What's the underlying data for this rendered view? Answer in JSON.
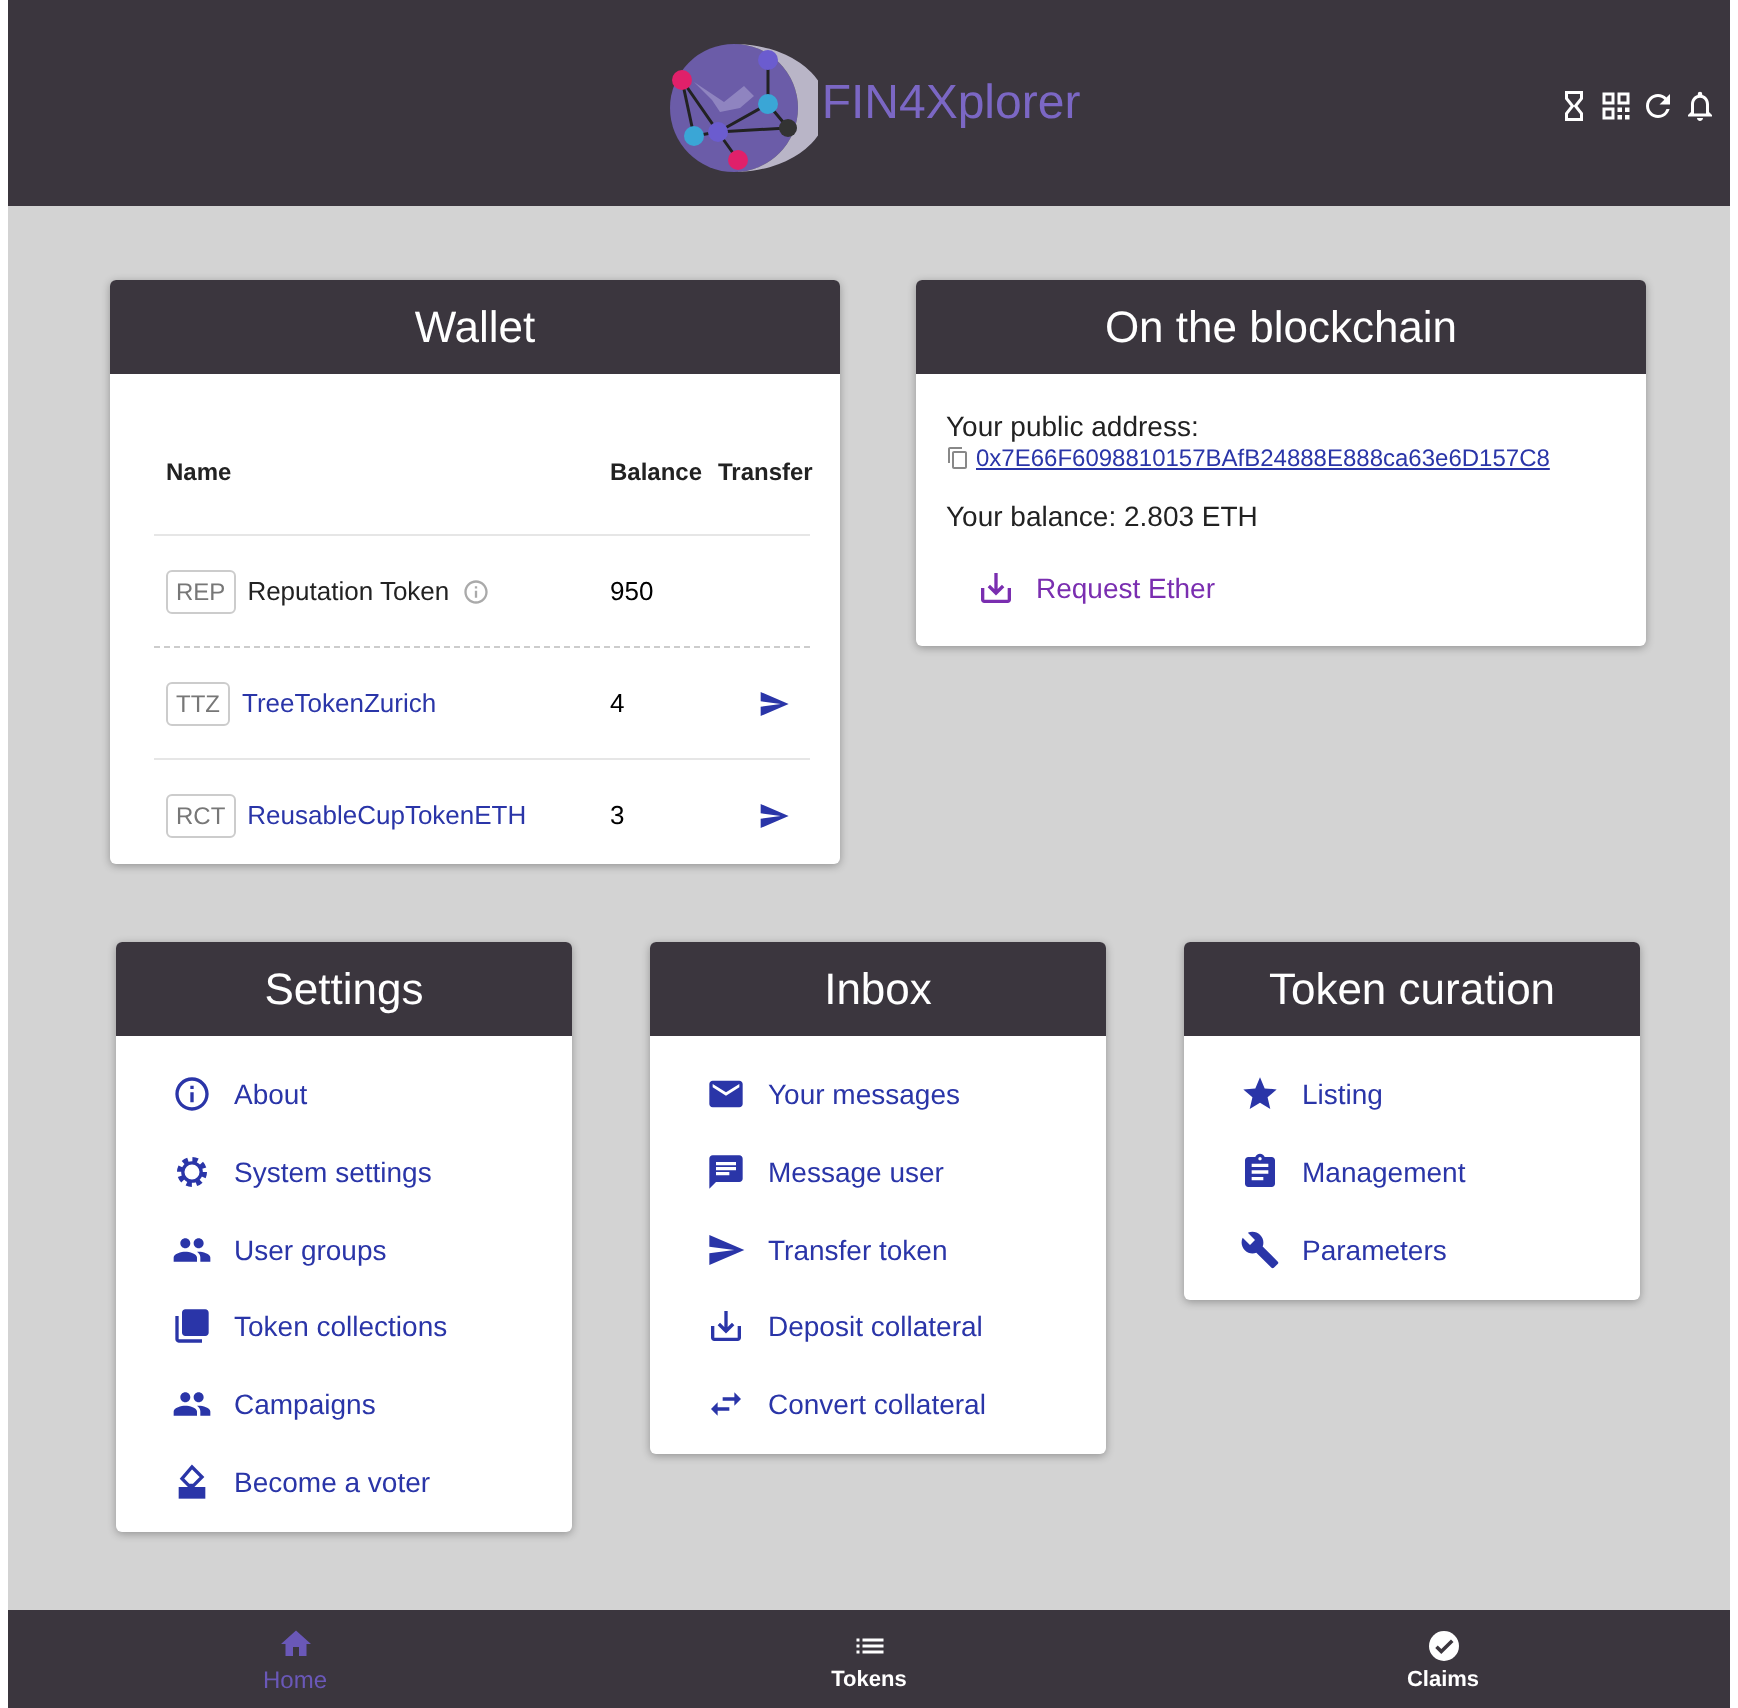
{
  "header": {
    "title": "FIN4Xplorer"
  },
  "wallet": {
    "title": "Wallet",
    "columns": [
      "Name",
      "Balance",
      "Transfer"
    ],
    "rows": [
      {
        "symbol": "REP",
        "name": "Reputation Token",
        "balance": "950",
        "info": true,
        "transferable": false
      },
      {
        "symbol": "TTZ",
        "name": "TreeTokenZurich",
        "balance": "4",
        "info": false,
        "transferable": true
      },
      {
        "symbol": "RCT",
        "name": "ReusableCupTokenETH",
        "balance": "3",
        "info": false,
        "transferable": true
      }
    ]
  },
  "blockchain": {
    "title": "On the blockchain",
    "address_label": "Your public address:",
    "address": "0x7E66F6098810157BAfB24888E888ca63e6D157C8",
    "balance": "Your balance: 2.803 ETH",
    "action": "Request Ether"
  },
  "menus": [
    {
      "title": "Settings",
      "items": [
        {
          "label": "About"
        },
        {
          "label": "System settings"
        },
        {
          "label": "User groups"
        },
        {
          "label": "Token collections"
        },
        {
          "label": "Campaigns"
        },
        {
          "label": "Become a voter"
        }
      ]
    },
    {
      "title": "Inbox",
      "items": [
        {
          "label": "Your messages"
        },
        {
          "label": "Message user"
        },
        {
          "label": "Transfer token"
        },
        {
          "label": "Deposit collateral"
        },
        {
          "label": "Convert collateral"
        }
      ]
    },
    {
      "title": "Token curation",
      "items": [
        {
          "label": "Listing"
        },
        {
          "label": "Management"
        },
        {
          "label": "Parameters"
        }
      ]
    }
  ],
  "nav": [
    {
      "label": "Home",
      "selected": true
    },
    {
      "label": "Tokens",
      "selected": false
    },
    {
      "label": "Claims",
      "selected": false
    }
  ]
}
